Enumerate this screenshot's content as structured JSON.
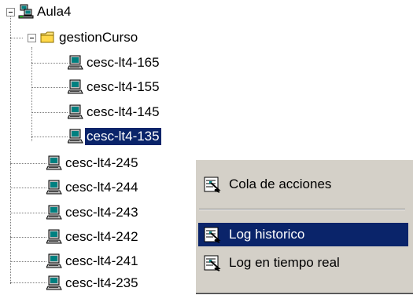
{
  "tree": {
    "root": {
      "label": "Aula4",
      "icon": "network-group-icon"
    },
    "group": {
      "label": "gestionCurso",
      "icon": "folder-icon"
    },
    "group_children": [
      {
        "label": "cesc-lt4-165",
        "selected": false
      },
      {
        "label": "cesc-lt4-155",
        "selected": false
      },
      {
        "label": "cesc-lt4-145",
        "selected": false
      },
      {
        "label": "cesc-lt4-135",
        "selected": true
      }
    ],
    "root_children": [
      {
        "label": "cesc-lt4-245"
      },
      {
        "label": "cesc-lt4-244"
      },
      {
        "label": "cesc-lt4-243"
      },
      {
        "label": "cesc-lt4-242"
      },
      {
        "label": "cesc-lt4-241"
      },
      {
        "label": "cesc-lt4-235"
      }
    ],
    "child_icon": "computer-icon",
    "selection_color": "#0a246a"
  },
  "context_menu": {
    "items": [
      {
        "label": "Cola de acciones",
        "icon": "actions-icon",
        "highlighted": false
      },
      {
        "label": "Log historico",
        "icon": "log-history-icon",
        "highlighted": true
      },
      {
        "label": "Log en tiempo real",
        "icon": "log-realtime-icon",
        "highlighted": false
      }
    ],
    "background": "#d4d0c8",
    "highlight_color": "#0a246a"
  }
}
